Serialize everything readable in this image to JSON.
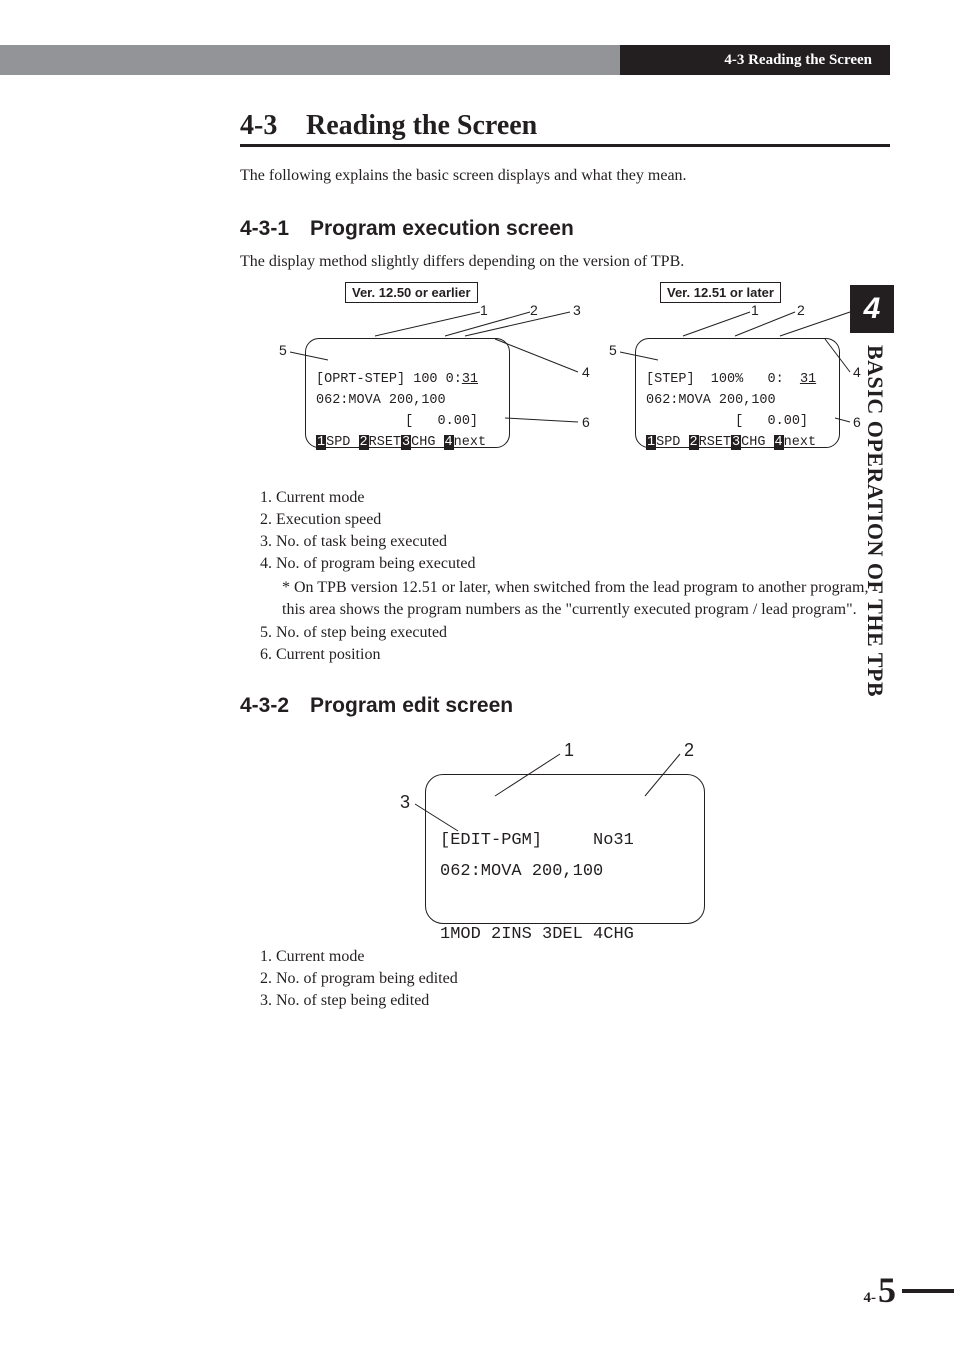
{
  "header": {
    "running": "4-3 Reading the Screen"
  },
  "chapter": {
    "tab": "4",
    "side": "BASIC OPERATION OF THE TPB"
  },
  "h1": {
    "num": "4-3",
    "title": "Reading the Screen"
  },
  "intro": "The following explains the basic screen displays and what they mean.",
  "s1": {
    "num": "4-3-1",
    "title": "Program execution screen",
    "intro": "The display method slightly differs depending on the version of TPB.",
    "verA": "Ver. 12.50 or earlier",
    "verB": "Ver. 12.51 or later",
    "lcdA": {
      "l1a": "[OPRT-STEP] 100 0:",
      "l1b": "31",
      "l2": "062:MOVA 200,100",
      "l3": "           [   0.00]",
      "fk1": "1",
      "fk1t": "SPD ",
      "fk2": "2",
      "fk2t": "RSET",
      "fk3": "3",
      "fk3t": "CHG ",
      "fk4": "4",
      "fk4t": "next"
    },
    "lcdB": {
      "l1a": "[STEP]  100%   0:  ",
      "l1b": "31",
      "l2": "062:MOVA 200,100",
      "l3": "           [   0.00]",
      "fk1": "1",
      "fk1t": "SPD ",
      "fk2": "2",
      "fk2t": "RSET",
      "fk3": "3",
      "fk3t": "CHG ",
      "fk4": "4",
      "fk4t": "next"
    },
    "callouts": {
      "c1": "1",
      "c2": "2",
      "c3": "3",
      "c4": "4",
      "c5": "5",
      "c6": "6"
    },
    "legend": {
      "i1": "1.  Current mode",
      "i2": "2.  Execution speed",
      "i3": "3.  No. of task being executed",
      "i4": "4.  No. of program being executed",
      "note": "* On TPB version 12.51 or later, when switched from the lead program to another program, this area shows the program numbers as the \"currently executed program / lead program\".",
      "i5": "5.  No. of step being executed",
      "i6": "6.  Current position"
    }
  },
  "s2": {
    "num": "4-3-2",
    "title": "Program edit screen",
    "lcd": {
      "l1a": "[EDIT-PGM]     ",
      "l1b": "No31",
      "l2": "062:MOVA 200,100",
      "l3": "",
      "fk1": "1",
      "fk1t": "MOD ",
      "fk2": "2",
      "fk2t": "INS ",
      "fk3": "3",
      "fk3t": "DEL ",
      "fk4": "4",
      "fk4t": "CHG"
    },
    "callouts": {
      "c1": "1",
      "c2": "2",
      "c3": "3"
    },
    "legend": {
      "i1": "1.  Current mode",
      "i2": "2.  No. of program being edited",
      "i3": "3.  No. of step being edited"
    }
  },
  "page": {
    "prefix": "4-",
    "num": "5"
  }
}
